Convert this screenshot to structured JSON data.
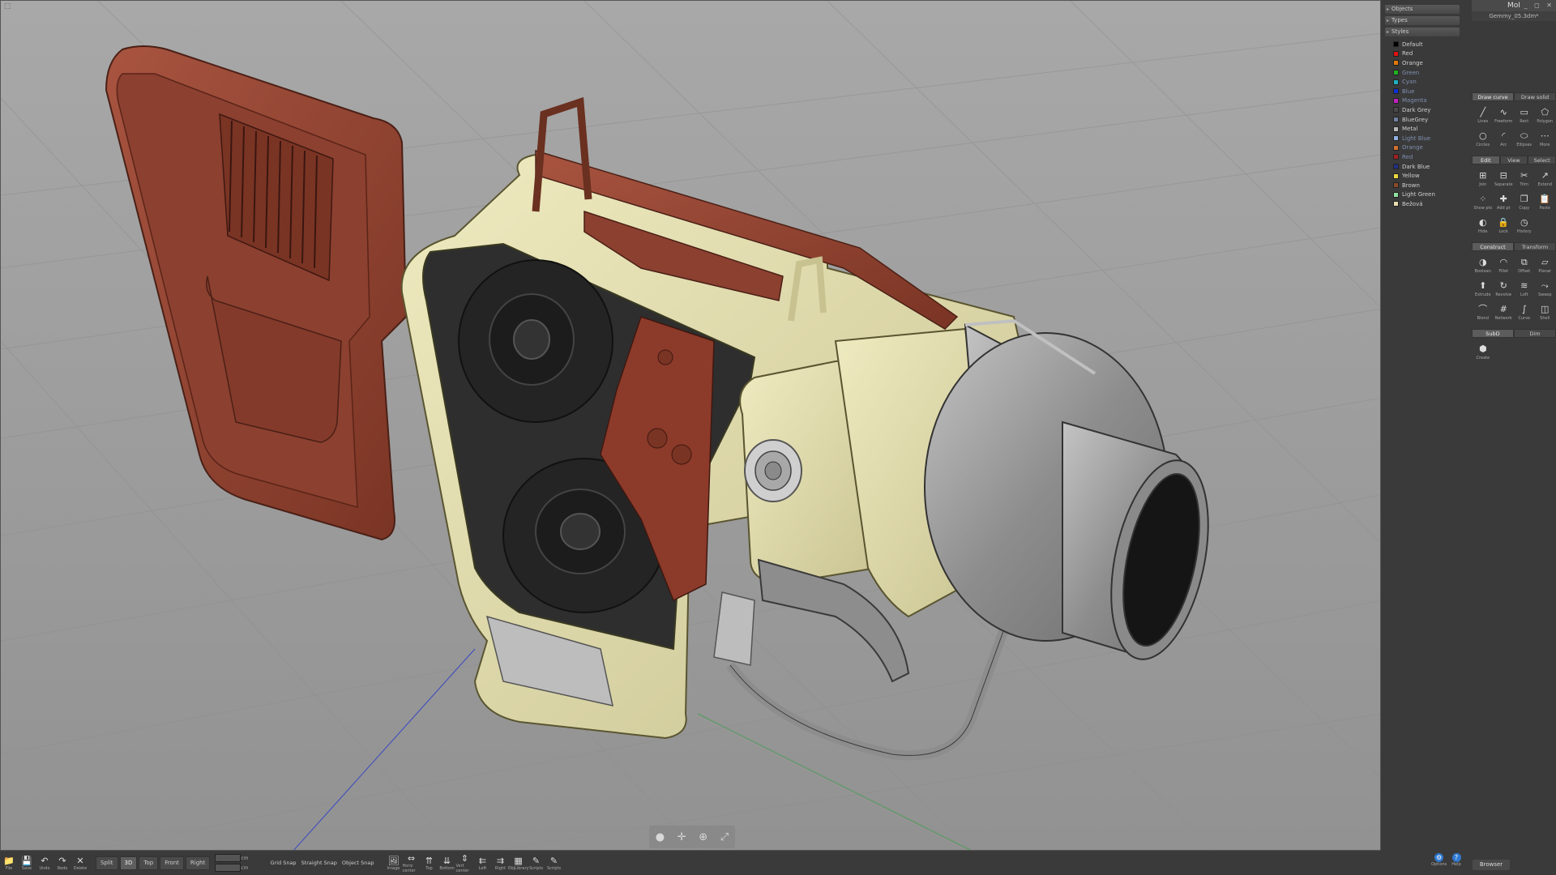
{
  "window": {
    "app_title": "MoI",
    "file_name": "Gemmy_05.3dm*",
    "controls": "_ ◻ ✕"
  },
  "left_panel": {
    "sections": [
      "Objects",
      "Types",
      "Styles"
    ],
    "styles": [
      {
        "name": "Default",
        "color": "#000000",
        "dim": false
      },
      {
        "name": "Red",
        "color": "#e01010",
        "dim": false
      },
      {
        "name": "Orange",
        "color": "#e0780a",
        "dim": false
      },
      {
        "name": "Green",
        "color": "#20b020",
        "dim": true
      },
      {
        "name": "Cyan",
        "color": "#20b0c0",
        "dim": true
      },
      {
        "name": "Blue",
        "color": "#1030d0",
        "dim": true
      },
      {
        "name": "Magenta",
        "color": "#c020c0",
        "dim": true
      },
      {
        "name": "Dark Grey",
        "color": "#4a4a4a",
        "dim": false
      },
      {
        "name": "BlueGrey",
        "color": "#7080a0",
        "dim": false
      },
      {
        "name": "Metal",
        "color": "#b8b8b8",
        "dim": false
      },
      {
        "name": "Light Blue",
        "color": "#90b0e0",
        "dim": true
      },
      {
        "name": "Orange",
        "color": "#d07030",
        "dim": true
      },
      {
        "name": "Red",
        "color": "#a02020",
        "dim": true
      },
      {
        "name": "Dark Blue",
        "color": "#203080",
        "dim": false
      },
      {
        "name": "Yellow",
        "color": "#e8d840",
        "dim": false
      },
      {
        "name": "Brown",
        "color": "#8a4a28",
        "dim": false
      },
      {
        "name": "Light Green",
        "color": "#90e0a0",
        "dim": false
      },
      {
        "name": "Bežová",
        "color": "#e4dcb0",
        "dim": false
      }
    ]
  },
  "tools": {
    "draw_tabs": [
      "Draw curve",
      "Draw solid"
    ],
    "draw_tools": [
      {
        "label": "Lines",
        "icon": "line-icon",
        "glyph": "╱"
      },
      {
        "label": "Freeform",
        "icon": "freeform-icon",
        "glyph": "∿"
      },
      {
        "label": "Rect",
        "icon": "rect-icon",
        "glyph": "▭"
      },
      {
        "label": "Polygon",
        "icon": "polygon-icon",
        "glyph": "⬠"
      },
      {
        "label": "Circles",
        "icon": "circle-icon",
        "glyph": "○"
      },
      {
        "label": "Arc",
        "icon": "arc-icon",
        "glyph": "◜"
      },
      {
        "label": "Ellipses",
        "icon": "ellipse-icon",
        "glyph": "⬭"
      },
      {
        "label": "More",
        "icon": "more-icon",
        "glyph": "⋯"
      }
    ],
    "edit_tabs": [
      "Edit",
      "View",
      "Select"
    ],
    "edit_tools": [
      {
        "label": "Join",
        "icon": "join-icon",
        "glyph": "⊞"
      },
      {
        "label": "Separate",
        "icon": "separate-icon",
        "glyph": "⊟"
      },
      {
        "label": "Trim",
        "icon": "trim-icon",
        "glyph": "✂"
      },
      {
        "label": "Extend",
        "icon": "extend-icon",
        "glyph": "↗"
      },
      {
        "label": "Show pts",
        "icon": "show-points-icon",
        "glyph": "⁘"
      },
      {
        "label": "Add pt",
        "icon": "add-point-icon",
        "glyph": "✚"
      },
      {
        "label": "Copy",
        "icon": "copy-icon",
        "glyph": "❐"
      },
      {
        "label": "Paste",
        "icon": "paste-icon",
        "glyph": "📋"
      },
      {
        "label": "Hide",
        "icon": "hide-icon",
        "glyph": "◐"
      },
      {
        "label": "Lock",
        "icon": "lock-icon",
        "glyph": "🔒"
      },
      {
        "label": "History",
        "icon": "history-icon",
        "glyph": "◷"
      }
    ],
    "construct_tabs": [
      "Construct",
      "Transform"
    ],
    "construct_tools": [
      {
        "label": "Boolean",
        "icon": "boolean-icon",
        "glyph": "◑"
      },
      {
        "label": "Fillet",
        "icon": "fillet-icon",
        "glyph": "◠"
      },
      {
        "label": "Offset",
        "icon": "offset-icon",
        "glyph": "⧉"
      },
      {
        "label": "Planar",
        "icon": "planar-icon",
        "glyph": "▱"
      },
      {
        "label": "Extrude",
        "icon": "extrude-icon",
        "glyph": "⬆"
      },
      {
        "label": "Revolve",
        "icon": "revolve-icon",
        "glyph": "↻"
      },
      {
        "label": "Loft",
        "icon": "loft-icon",
        "glyph": "≋"
      },
      {
        "label": "Sweep",
        "icon": "sweep-icon",
        "glyph": "⤳"
      },
      {
        "label": "Blend",
        "icon": "blend-icon",
        "glyph": "⌒"
      },
      {
        "label": "Network",
        "icon": "network-icon",
        "glyph": "#"
      },
      {
        "label": "Curve",
        "icon": "curve-icon",
        "glyph": "∫"
      },
      {
        "label": "Shell",
        "icon": "shell-icon",
        "glyph": "◫"
      }
    ],
    "subd_tabs": [
      "SubD",
      "Dim"
    ],
    "subd_tools": [
      {
        "label": "Create",
        "icon": "subd-create-icon",
        "glyph": "⬢"
      }
    ],
    "options_label": "Options",
    "help_label": "Help",
    "browser_label": "Browser"
  },
  "bottombar": {
    "file_buttons": [
      {
        "label": "File",
        "icon": "folder-icon",
        "glyph": "📁"
      },
      {
        "label": "Save",
        "icon": "save-icon",
        "glyph": "💾"
      },
      {
        "label": "Undo",
        "icon": "undo-icon",
        "glyph": "↶"
      },
      {
        "label": "Redo",
        "icon": "redo-icon",
        "glyph": "↷"
      },
      {
        "label": "Delete",
        "icon": "delete-icon",
        "glyph": "✕"
      }
    ],
    "views": [
      "Split",
      "3D",
      "Top",
      "Front",
      "Right"
    ],
    "active_view": "3D",
    "grid_units": [
      "cm",
      "cm"
    ],
    "snaps": [
      "Grid Snap",
      "Straight Snap",
      "Object Snap"
    ],
    "view_tools": [
      {
        "label": "Image",
        "icon": "image-icon",
        "glyph": "🖼"
      },
      {
        "label": "Horiz center",
        "icon": "horiz-center-icon",
        "glyph": "⇔"
      },
      {
        "label": "Top",
        "icon": "align-top-icon",
        "glyph": "⇈"
      },
      {
        "label": "Bottom",
        "icon": "align-bottom-icon",
        "glyph": "⇊"
      },
      {
        "label": "Vert center",
        "icon": "vert-center-icon",
        "glyph": "⇕"
      },
      {
        "label": "Left",
        "icon": "align-left-icon",
        "glyph": "⇇"
      },
      {
        "label": "Right",
        "icon": "align-right-icon",
        "glyph": "⇉"
      },
      {
        "label": "ObjLibrary",
        "icon": "library-icon",
        "glyph": "▦"
      },
      {
        "label": "Scripts",
        "icon": "scripts-icon",
        "glyph": "✎"
      },
      {
        "label": "Scripts",
        "icon": "scripts-icon",
        "glyph": "✎"
      }
    ]
  }
}
